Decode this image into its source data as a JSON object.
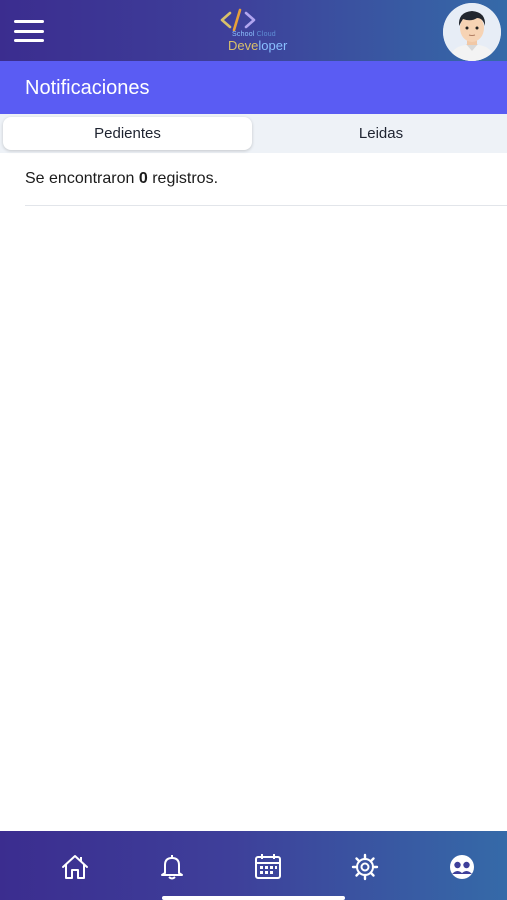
{
  "header": {
    "logo": {
      "school": "School",
      "cloud": "Cloud",
      "developer_a": "Deve",
      "developer_b": "loper"
    }
  },
  "page": {
    "title": "Notificaciones"
  },
  "tabs": [
    {
      "label": "Pedientes",
      "active": true
    },
    {
      "label": "Leidas",
      "active": false
    }
  ],
  "result": {
    "prefix": "Se encontraron",
    "count": "0",
    "suffix": "registros."
  },
  "bottom_nav": [
    {
      "icon": "home-icon"
    },
    {
      "icon": "bell-icon"
    },
    {
      "icon": "calendar-icon"
    },
    {
      "icon": "gear-icon"
    },
    {
      "icon": "users-icon"
    }
  ],
  "colors": {
    "header_gradient_start": "#3b2d8f",
    "header_gradient_end": "#356aa8",
    "title_band": "#5a5cf3",
    "tabs_background": "#eef2f7"
  }
}
